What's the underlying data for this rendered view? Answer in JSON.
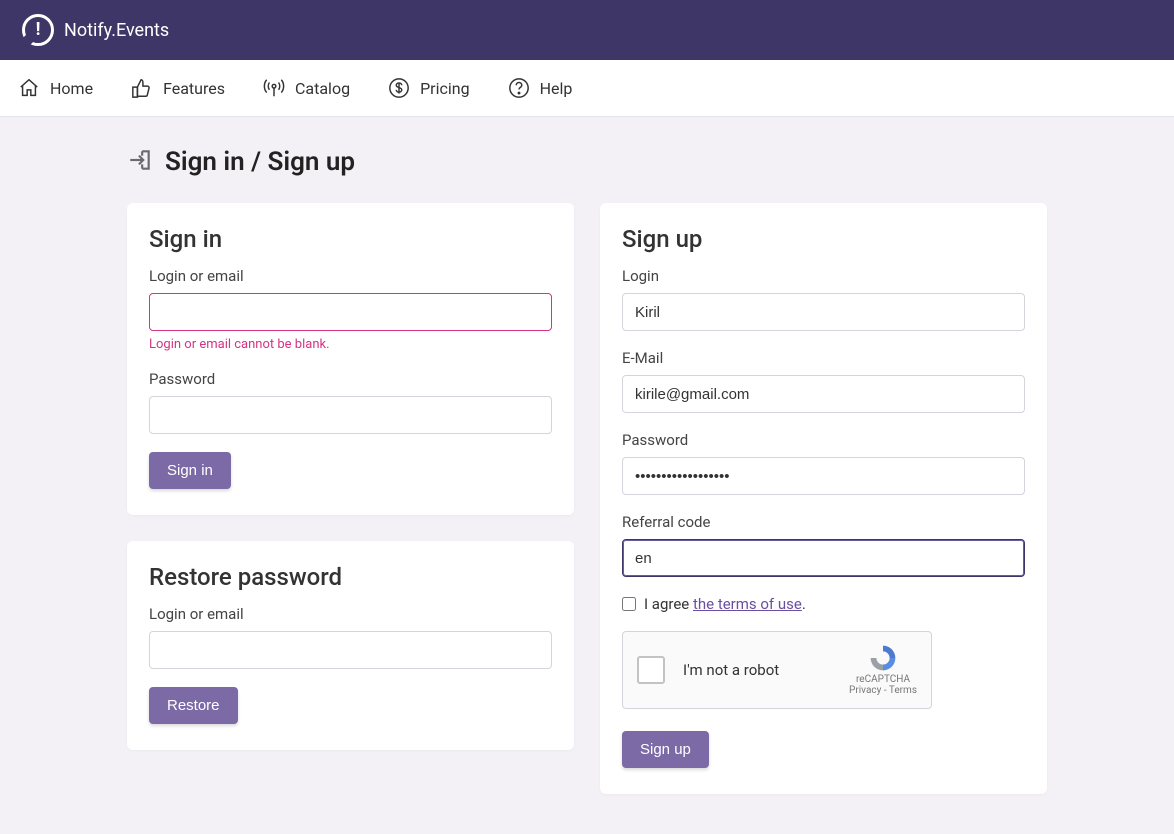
{
  "brand": "Notify.Events",
  "nav": {
    "home": "Home",
    "features": "Features",
    "catalog": "Catalog",
    "pricing": "Pricing",
    "help": "Help"
  },
  "page_title": "Sign in / Sign up",
  "signin": {
    "heading": "Sign in",
    "login_label": "Login or email",
    "login_value": "",
    "login_error": "Login or email cannot be blank.",
    "password_label": "Password",
    "password_value": "",
    "submit": "Sign in"
  },
  "restore": {
    "heading": "Restore password",
    "login_label": "Login or email",
    "login_value": "",
    "submit": "Restore"
  },
  "signup": {
    "heading": "Sign up",
    "login_label": "Login",
    "login_value": "Kiril",
    "email_label": "E-Mail",
    "email_value": "kirile@gmail.com",
    "password_label": "Password",
    "password_value": "••••••••••••••••••",
    "referral_label": "Referral code",
    "referral_value": "en",
    "agree_prefix": "I agree ",
    "terms_link": "the terms of use",
    "agree_suffix": ".",
    "recaptcha_label": "I'm not a robot",
    "recaptcha_brand": "reCAPTCHA",
    "recaptcha_links": "Privacy - Terms",
    "submit": "Sign up"
  },
  "colors": {
    "accent": "#7b6aa6",
    "header": "#3e3667",
    "error": "#d63384"
  }
}
